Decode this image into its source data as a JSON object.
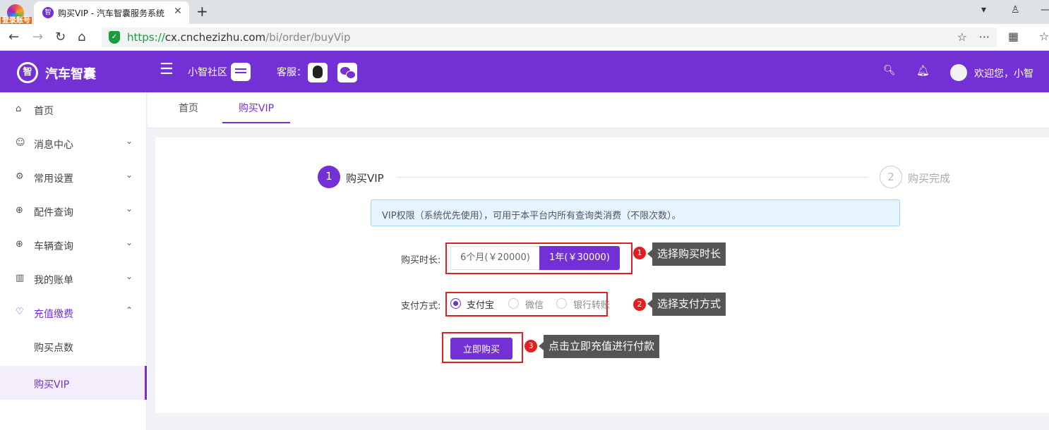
{
  "browser": {
    "login_badge": "登录账号",
    "tab_title": "购买VIP - 汽车智囊服务系统",
    "tab_favicon": "智",
    "url_https": "https://",
    "url_host": "cx.cnchezizhu.com",
    "url_path": "/bi/order/buyVip"
  },
  "header": {
    "logo_text": "智",
    "brand": "汽车智囊",
    "community": "小智社区",
    "service": "客服：",
    "welcome": "欢迎您，小智"
  },
  "sidebar": {
    "items": [
      {
        "label": "首页",
        "icon": "⌂"
      },
      {
        "label": "消息中心",
        "icon": "☺"
      },
      {
        "label": "常用设置",
        "icon": "⚙"
      },
      {
        "label": "配件查询",
        "icon": "⊕"
      },
      {
        "label": "车辆查询",
        "icon": "⊕"
      },
      {
        "label": "我的账单",
        "icon": "▥"
      },
      {
        "label": "充值缴费",
        "icon": "♡"
      }
    ],
    "sub_items": [
      {
        "label": "购买点数"
      },
      {
        "label": "购买VIP"
      }
    ]
  },
  "page_tabs": [
    {
      "label": "首页"
    },
    {
      "label": "购买VIP"
    }
  ],
  "steps": [
    {
      "num": "1",
      "label": "购买VIP"
    },
    {
      "num": "2",
      "label": "购买完成"
    }
  ],
  "notice": "VIP权限（系统优先使用），可用于本平台内所有查询类消费（不限次数）。",
  "form": {
    "duration_label": "购买时长:",
    "duration_options": [
      {
        "label": "6个月(￥20000)"
      },
      {
        "label": "1年(￥30000)"
      }
    ],
    "payment_label": "支付方式:",
    "payment_options": [
      {
        "label": "支付宝"
      },
      {
        "label": "微信"
      },
      {
        "label": "银行转账"
      }
    ],
    "buy_button": "立即购买"
  },
  "callouts": [
    {
      "num": "1",
      "text": "选择购买时长"
    },
    {
      "num": "2",
      "text": "选择支付方式"
    },
    {
      "num": "3",
      "text": "点击立即充值进行付款"
    }
  ],
  "colors": {
    "primary": "#7330d4",
    "annotation_red": "#e02020",
    "callout_bg": "#555555"
  }
}
